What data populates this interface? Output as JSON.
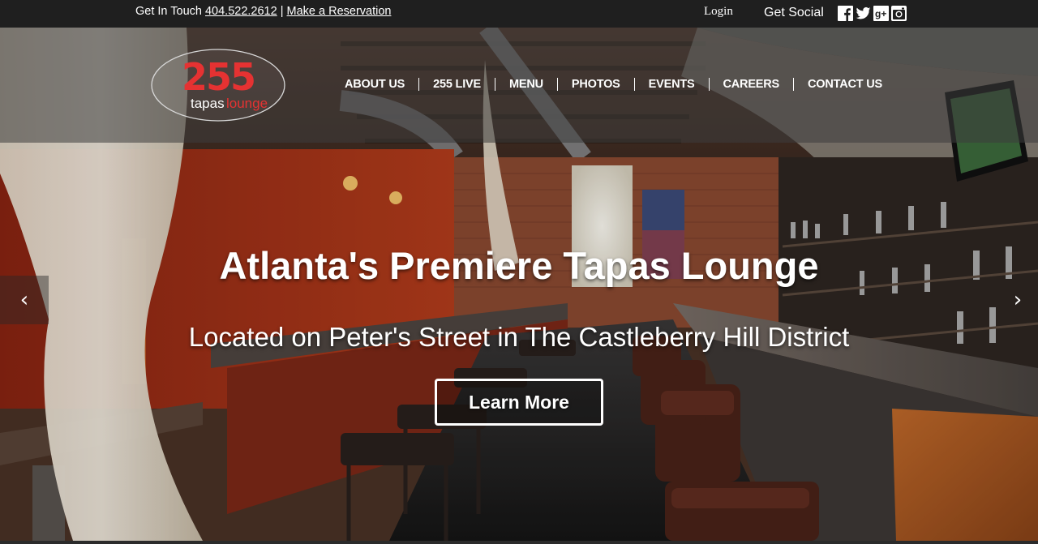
{
  "topbar": {
    "get_in_touch": "Get In Touch",
    "phone": " 404.522.2612",
    "separator": " | ",
    "reservation": " Make a Reservation",
    "login": "Login",
    "get_social": "Get Social",
    "social_icons": [
      "facebook-icon",
      "twitter-icon",
      "google-plus-icon",
      "instagram-icon"
    ]
  },
  "logo": {
    "number": "255",
    "word1": "tapas",
    "word2": "lounge",
    "accent_color": "#e53232"
  },
  "nav": {
    "items": [
      {
        "label": "ABOUT US"
      },
      {
        "label": "255 LIVE"
      },
      {
        "label": "MENU"
      },
      {
        "label": "PHOTOS"
      },
      {
        "label": "EVENTS"
      },
      {
        "label": "CAREERS"
      },
      {
        "label": "CONTACT US"
      }
    ]
  },
  "hero": {
    "headline": "Atlanta's Premiere Tapas Lounge",
    "subhead": "Located on Peter's Street in The Castleberry Hill District",
    "cta": "Learn More",
    "prev_arrow": "‹",
    "next_arrow": "›"
  },
  "colors": {
    "topbar_bg": "#1f1f1f",
    "brand_red": "#e53232"
  }
}
